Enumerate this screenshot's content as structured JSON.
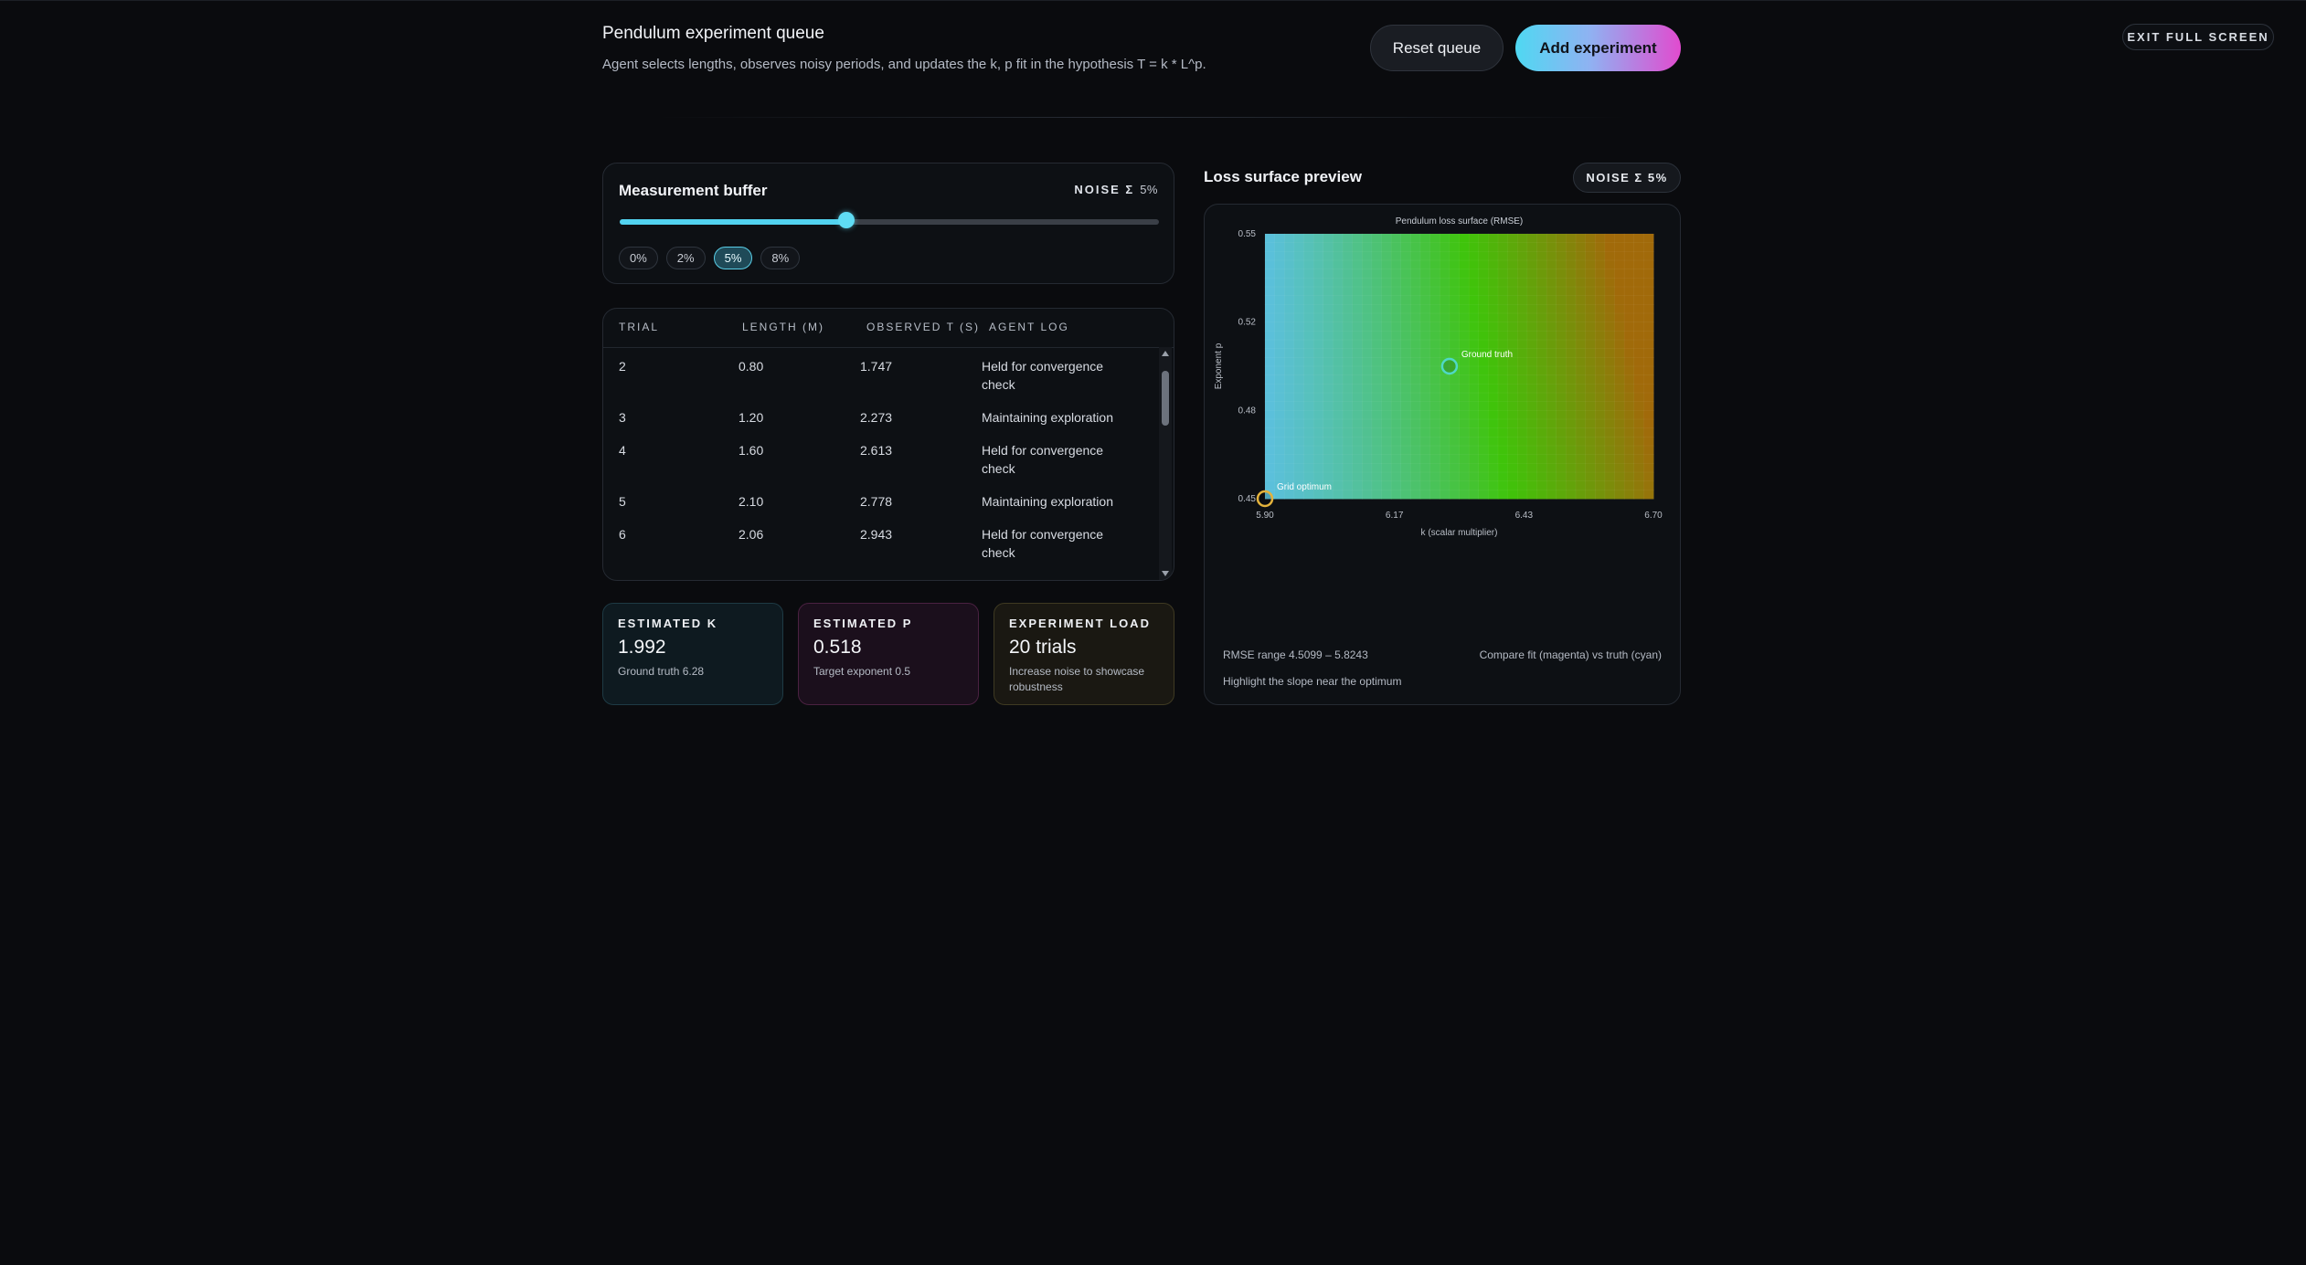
{
  "header": {
    "title": "Pendulum experiment queue",
    "subtitle": "Agent selects lengths, observes noisy periods, and updates the k, p fit in the hypothesis T = k * L^p.",
    "reset_label": "Reset queue",
    "add_label": "Add experiment",
    "exit_label": "EXIT FULL SCREEN"
  },
  "buffer": {
    "title": "Measurement buffer",
    "noise_label": "NOISE Σ",
    "noise_value": "5%",
    "slider_fraction": 0.42,
    "chips": [
      "0%",
      "2%",
      "5%",
      "8%"
    ],
    "active_chip": 2
  },
  "table": {
    "headers": [
      "TRIAL",
      "LENGTH (M)",
      "OBSERVED T (S)",
      "AGENT LOG"
    ],
    "rows": [
      {
        "trial": "2",
        "length": "0.80",
        "period": "1.747",
        "log": "Held for convergence check"
      },
      {
        "trial": "3",
        "length": "1.20",
        "period": "2.273",
        "log": "Maintaining exploration"
      },
      {
        "trial": "4",
        "length": "1.60",
        "period": "2.613",
        "log": "Held for convergence check"
      },
      {
        "trial": "5",
        "length": "2.10",
        "period": "2.778",
        "log": "Maintaining exploration"
      },
      {
        "trial": "6",
        "length": "2.06",
        "period": "2.943",
        "log": "Held for convergence check"
      }
    ]
  },
  "stats": {
    "k": {
      "label": "ESTIMATED K",
      "value": "1.992",
      "sub": "Ground truth 6.28"
    },
    "p": {
      "label": "ESTIMATED P",
      "value": "0.518",
      "sub": "Target exponent 0.5"
    },
    "load": {
      "label": "EXPERIMENT LOAD",
      "value": "20 trials",
      "sub": "Increase noise to showcase robustness"
    }
  },
  "loss_surface": {
    "title": "Loss surface preview",
    "badge": "NOISE Σ 5%",
    "footer_range": "RMSE range 4.5099 – 5.8243",
    "footer_compare": "Compare fit (magenta) vs truth (cyan)",
    "footer_hint": "Highlight the slope near the optimum"
  },
  "chart_data": {
    "type": "heatmap",
    "title": "Pendulum loss surface (RMSE)",
    "xlabel": "k (scalar multiplier)",
    "ylabel": "Exponent p",
    "x_ticks": [
      "5.90",
      "6.17",
      "6.43",
      "6.70"
    ],
    "y_ticks": [
      "0.55",
      "0.52",
      "0.48",
      "0.45"
    ],
    "xlim": [
      5.9,
      6.7
    ],
    "ylim": [
      0.45,
      0.55
    ],
    "value_range": [
      4.5099,
      5.8243
    ],
    "colormap": [
      "#5bc0de",
      "#3fc40a",
      "#a16a0a"
    ],
    "markers": [
      {
        "label": "Ground truth",
        "k": 6.28,
        "p": 0.5,
        "color": "#4fd8c6"
      },
      {
        "label": "Grid optimum",
        "k": 5.9,
        "p": 0.45,
        "color": "#e3b23c"
      }
    ]
  }
}
